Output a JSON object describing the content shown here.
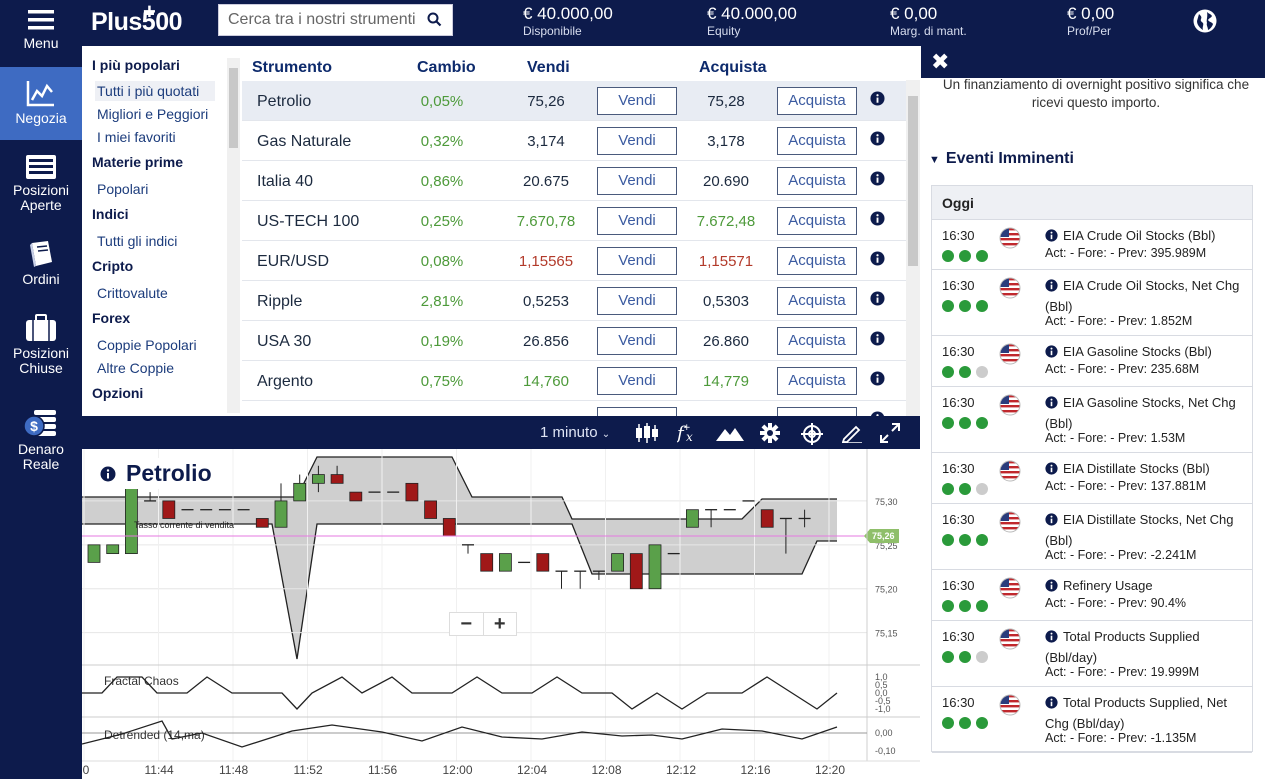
{
  "header": {
    "logo": "Plus500",
    "search_placeholder": "Cerca tra i nostri strumenti",
    "stats": [
      {
        "value": "€ 40.000,00",
        "label": "Disponibile"
      },
      {
        "value": "€ 40.000,00",
        "label": "Equity"
      },
      {
        "value": "€ 0,00",
        "label": "Marg. di mant."
      },
      {
        "value": "€ 0,00",
        "label": "Prof/Per"
      }
    ]
  },
  "nav": [
    {
      "label": "Menu",
      "icon": "hamburger-icon"
    },
    {
      "label": "Negozia",
      "icon": "chart-line-icon",
      "active": true
    },
    {
      "label": "Posizioni Aperte",
      "icon": "list-icon"
    },
    {
      "label": "Ordini",
      "icon": "book-icon"
    },
    {
      "label": "Posizioni Chiuse",
      "icon": "briefcase-icon"
    },
    {
      "label": "Denaro Reale",
      "icon": "money-icon"
    }
  ],
  "categories": [
    {
      "type": "header",
      "label": "I più popolari"
    },
    {
      "type": "item",
      "label": "Tutti i più quotati",
      "selected": true
    },
    {
      "type": "item",
      "label": "Migliori e Peggiori"
    },
    {
      "type": "item",
      "label": "I miei favoriti"
    },
    {
      "type": "header",
      "label": "Materie prime"
    },
    {
      "type": "item",
      "label": "Popolari"
    },
    {
      "type": "header",
      "label": "Indici"
    },
    {
      "type": "item",
      "label": "Tutti gli indici"
    },
    {
      "type": "header",
      "label": "Cripto"
    },
    {
      "type": "item",
      "label": "Crittovalute"
    },
    {
      "type": "header",
      "label": "Forex"
    },
    {
      "type": "item",
      "label": "Coppie Popolari"
    },
    {
      "type": "item",
      "label": "Altre Coppie"
    },
    {
      "type": "header",
      "label": "Opzioni"
    }
  ],
  "table": {
    "headers": {
      "instrument": "Strumento",
      "change": "Cambio",
      "sell": "Vendi",
      "buy": "Acquista"
    },
    "sell_button": "Vendi",
    "buy_button": "Acquista",
    "rows": [
      {
        "name": "Petrolio",
        "change": "0,05%",
        "sell": "75,26",
        "buy": "75,28",
        "color": "normal",
        "selected": true
      },
      {
        "name": "Gas Naturale",
        "change": "0,32%",
        "sell": "3,174",
        "buy": "3,178",
        "color": "normal"
      },
      {
        "name": "Italia 40",
        "change": "0,86%",
        "sell": "20.675",
        "buy": "20.690",
        "color": "normal"
      },
      {
        "name": "US-TECH 100",
        "change": "0,25%",
        "sell": "7.670,78",
        "buy": "7.672,48",
        "color": "green"
      },
      {
        "name": "EUR/USD",
        "change": "0,08%",
        "sell": "1,15565",
        "buy": "1,15571",
        "color": "red"
      },
      {
        "name": "Ripple",
        "change": "2,81%",
        "sell": "0,5253",
        "buy": "0,5303",
        "color": "normal"
      },
      {
        "name": "USA 30",
        "change": "0,19%",
        "sell": "26.856",
        "buy": "26.860",
        "color": "normal"
      },
      {
        "name": "Argento",
        "change": "0,75%",
        "sell": "14,760",
        "buy": "14,779",
        "color": "green"
      }
    ]
  },
  "chart_toolbar": {
    "timeframe": "1 minuto"
  },
  "chart": {
    "title": "Petrolio",
    "current_rate_label": "Tasso corrente di vendita",
    "current_price": "75,26",
    "price_ticks": [
      "75,30",
      "75,25",
      "75,20",
      "75,15"
    ],
    "time_ticks": [
      "0",
      "11:44",
      "11:48",
      "11:52",
      "11:56",
      "12:00",
      "12:04",
      "12:08",
      "12:12",
      "12:16",
      "12:20"
    ],
    "indicator1": {
      "name": "Fractal Chaos",
      "ticks": [
        "1,0",
        "0,5",
        "0,0",
        "-0,5",
        "-1,0"
      ]
    },
    "indicator2": {
      "name": "Detrended (14,ma)",
      "ticks": [
        "0,00",
        "-0,10"
      ]
    },
    "zoom_out": "−",
    "zoom_in": "+"
  },
  "chart_data": {
    "type": "candlestick",
    "title": "Petrolio",
    "x": [
      "11:42",
      "11:43",
      "11:44",
      "11:45",
      "11:46",
      "11:47",
      "11:48",
      "11:49",
      "11:50",
      "11:51",
      "11:52",
      "11:53",
      "11:54",
      "11:55",
      "11:56",
      "11:57",
      "11:58",
      "11:59",
      "12:00",
      "12:01",
      "12:02",
      "12:03",
      "12:04",
      "12:05",
      "12:06",
      "12:07",
      "12:08",
      "12:09",
      "12:10",
      "12:11",
      "12:12",
      "12:13",
      "12:14",
      "12:15",
      "12:16",
      "12:17",
      "12:18",
      "12:19",
      "12:20"
    ],
    "series": [
      {
        "values": [
          {
            "o": 75.23,
            "c": 75.25,
            "h": 75.25,
            "l": 75.23
          },
          {
            "o": 75.24,
            "c": 75.25,
            "h": 75.25,
            "l": 75.24
          },
          {
            "o": 75.24,
            "c": 75.32,
            "h": 75.32,
            "l": 75.24
          },
          {
            "o": 75.3,
            "c": 75.3,
            "h": 75.31,
            "l": 75.3
          },
          {
            "o": 75.3,
            "c": 75.28,
            "h": 75.3,
            "l": 75.28
          },
          {
            "o": 75.29,
            "c": 75.29,
            "h": 75.29,
            "l": 75.29
          },
          {
            "o": 75.29,
            "c": 75.29,
            "h": 75.29,
            "l": 75.29
          },
          {
            "o": 75.29,
            "c": 75.29,
            "h": 75.29,
            "l": 75.29
          },
          {
            "o": 75.29,
            "c": 75.29,
            "h": 75.29,
            "l": 75.29
          },
          {
            "o": 75.28,
            "c": 75.27,
            "h": 75.28,
            "l": 75.27
          },
          {
            "o": 75.27,
            "c": 75.3,
            "h": 75.32,
            "l": 75.27
          },
          {
            "o": 75.3,
            "c": 75.32,
            "h": 75.33,
            "l": 75.3
          },
          {
            "o": 75.32,
            "c": 75.33,
            "h": 75.34,
            "l": 75.31
          },
          {
            "o": 75.33,
            "c": 75.32,
            "h": 75.34,
            "l": 75.32
          },
          {
            "o": 75.31,
            "c": 75.3,
            "h": 75.31,
            "l": 75.3
          },
          {
            "o": 75.31,
            "c": 75.31,
            "h": 75.31,
            "l": 75.31
          },
          {
            "o": 75.31,
            "c": 75.31,
            "h": 75.31,
            "l": 75.31
          },
          {
            "o": 75.32,
            "c": 75.3,
            "h": 75.32,
            "l": 75.3
          },
          {
            "o": 75.3,
            "c": 75.28,
            "h": 75.3,
            "l": 75.28
          },
          {
            "o": 75.28,
            "c": 75.26,
            "h": 75.28,
            "l": 75.26
          },
          {
            "o": 75.25,
            "c": 75.25,
            "h": 75.25,
            "l": 75.24
          },
          {
            "o": 75.24,
            "c": 75.22,
            "h": 75.24,
            "l": 75.22
          },
          {
            "o": 75.22,
            "c": 75.24,
            "h": 75.24,
            "l": 75.22
          },
          {
            "o": 75.23,
            "c": 75.23,
            "h": 75.23,
            "l": 75.23
          },
          {
            "o": 75.24,
            "c": 75.22,
            "h": 75.24,
            "l": 75.22
          },
          {
            "o": 75.22,
            "c": 75.22,
            "h": 75.22,
            "l": 75.2
          },
          {
            "o": 75.22,
            "c": 75.22,
            "h": 75.22,
            "l": 75.2
          },
          {
            "o": 75.22,
            "c": 75.22,
            "h": 75.22,
            "l": 75.21
          },
          {
            "o": 75.22,
            "c": 75.24,
            "h": 75.24,
            "l": 75.22
          },
          {
            "o": 75.24,
            "c": 75.2,
            "h": 75.24,
            "l": 75.2
          },
          {
            "o": 75.2,
            "c": 75.25,
            "h": 75.25,
            "l": 75.2
          },
          {
            "o": 75.24,
            "c": 75.24,
            "h": 75.24,
            "l": 75.24
          },
          {
            "o": 75.27,
            "c": 75.29,
            "h": 75.29,
            "l": 75.27
          },
          {
            "o": 75.29,
            "c": 75.29,
            "h": 75.29,
            "l": 75.27
          },
          {
            "o": 75.29,
            "c": 75.29,
            "h": 75.29,
            "l": 75.29
          },
          {
            "o": 75.3,
            "c": 75.3,
            "h": 75.3,
            "l": 75.3
          },
          {
            "o": 75.29,
            "c": 75.27,
            "h": 75.29,
            "l": 75.27
          },
          {
            "o": 75.28,
            "c": 75.28,
            "h": 75.28,
            "l": 75.24
          },
          {
            "o": 75.28,
            "c": 75.28,
            "h": 75.29,
            "l": 75.27
          }
        ]
      }
    ],
    "ylim": [
      75.12,
      75.35
    ],
    "current_price": 75.26
  },
  "right_panel": {
    "note": "Un finanziamento di overnight positivo significa che ricevi questo importo.",
    "events_title": "Eventi Imminenti",
    "day_header": "Oggi",
    "events": [
      {
        "time": "16:30",
        "title": "EIA Crude Oil Stocks (Bbl)",
        "values": "Act: - Fore: - Prev: 395.989M",
        "importance": 3
      },
      {
        "time": "16:30",
        "title": "EIA Crude Oil Stocks, Net Chg (Bbl)",
        "values": "Act: - Fore: - Prev: 1.852M",
        "importance": 3
      },
      {
        "time": "16:30",
        "title": "EIA Gasoline Stocks (Bbl)",
        "values": "Act: - Fore: - Prev: 235.68M",
        "importance": 2
      },
      {
        "time": "16:30",
        "title": "EIA Gasoline Stocks, Net Chg (Bbl)",
        "values": "Act: - Fore: - Prev: 1.53M",
        "importance": 3
      },
      {
        "time": "16:30",
        "title": "EIA Distillate Stocks (Bbl)",
        "values": "Act: - Fore: - Prev: 137.881M",
        "importance": 2
      },
      {
        "time": "16:30",
        "title": "EIA Distillate Stocks, Net Chg (Bbl)",
        "values": "Act: - Fore: - Prev: -2.241M",
        "importance": 3
      },
      {
        "time": "16:30",
        "title": "Refinery Usage",
        "values": "Act: - Fore: - Prev: 90.4%",
        "importance": 3
      },
      {
        "time": "16:30",
        "title": "Total Products Supplied (Bbl/day)",
        "values": "Act: - Fore: - Prev: 19.999M",
        "importance": 2
      },
      {
        "time": "16:30",
        "title": "Total Products Supplied, Net Chg (Bbl/day)",
        "values": "Act: - Fore: - Prev: -1.135M",
        "importance": 3
      }
    ]
  },
  "colors": {
    "navy": "#0d1b4c",
    "accent": "#3e6bc2",
    "green": "#4d9a3a",
    "red": "#b23a2a",
    "candle_up": "#5aa04a",
    "candle_down": "#a01818"
  }
}
